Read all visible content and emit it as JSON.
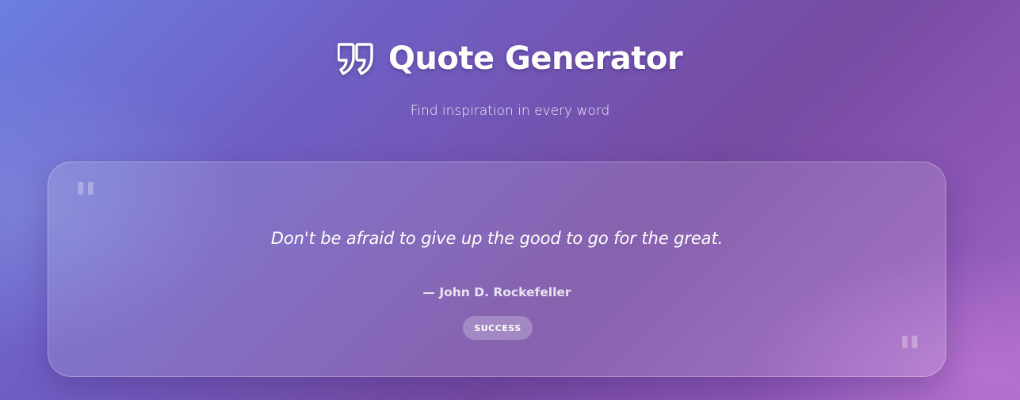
{
  "header": {
    "icon": "quote-left-icon",
    "title": "Quote Generator",
    "subtitle": "Find inspiration in every word"
  },
  "quote": {
    "text": "Don't be afraid to give up the good to go for the great.",
    "author": "— John D. Rockefeller",
    "category": "SUCCESS",
    "open_mark_icon": "quote-open-icon",
    "close_mark_icon": "quote-close-icon"
  },
  "colors": {
    "background_start": "#6c7fe0",
    "background_mid": "#764ba2",
    "background_end": "#a66ac6",
    "text": "#ffffff"
  }
}
